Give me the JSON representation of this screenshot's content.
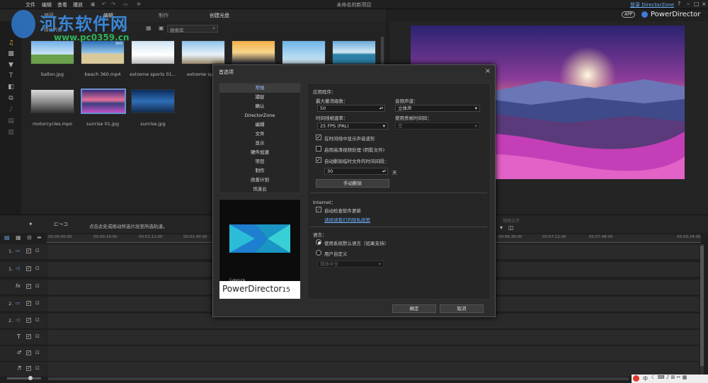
{
  "menubar": {
    "items": [
      "文件",
      "编辑",
      "查看",
      "播放"
    ],
    "title": "未命名的新项目",
    "signin": "登录 DirectorZone",
    "help": "?"
  },
  "tabs": [
    "捕获",
    "编辑",
    "制作",
    "创建光盘"
  ],
  "header": {
    "app_badge": "APP",
    "brand": "PowerDirector"
  },
  "library": {
    "filter_label": "媒体内容",
    "search_placeholder": "搜索库",
    "items": [
      {
        "label": "ballon.jpg"
      },
      {
        "label": "beach 360.mp4",
        "badge": "360"
      },
      {
        "label": "extreme sports 01..."
      },
      {
        "label": "extreme sport"
      },
      {
        "label": ""
      },
      {
        "label": ""
      },
      {
        "label": ""
      },
      {
        "label": "motorcycles.mpo"
      },
      {
        "label": "sunrise 01.jpg"
      },
      {
        "label": "sunrise.jpg"
      }
    ]
  },
  "midbar": {
    "hint": "点击此处或拖动所选片段至所选轨道。",
    "preview_dropdown": "视频文字"
  },
  "ruler": [
    "00:00:00:00",
    "00:00:16:00",
    "00:01:12:00",
    "00:01:40:00",
    "00:06:36:00",
    "00:07:12:00",
    "00:07:48:00",
    "00:09:24:00"
  ],
  "tracks": [
    {
      "name": "1.",
      "icon": "video-track-icon"
    },
    {
      "name": "1.",
      "icon": "audio-track-icon"
    },
    {
      "name": "fx",
      "icon": "fx-track-icon"
    },
    {
      "name": "2.",
      "icon": "video-track-icon"
    },
    {
      "name": "2.",
      "icon": "audio-track-icon"
    },
    {
      "name": "T",
      "icon": "title-track-icon"
    },
    {
      "name": "",
      "icon": "voice-track-icon"
    },
    {
      "name": "",
      "icon": "music-track-icon"
    }
  ],
  "dialog": {
    "title": "首选项",
    "close": "×",
    "nav": [
      "常规",
      "捕捉",
      "确认",
      "DirectorZone",
      "编辑",
      "文件",
      "显示",
      "硬件加速",
      "项目",
      "制作",
      "改善计划",
      "讯连云"
    ],
    "active_nav": 0,
    "logo": {
      "cyberlink": "CyberLink",
      "name": "PowerDirector",
      "version": "15"
    },
    "sections": {
      "app": {
        "heading": "应用程序：",
        "max_undo_label": "最大撤消级数：",
        "max_undo_value": "50",
        "audio_channel_label": "音频声道：",
        "audio_channel_value": "立体声",
        "timeline_fps_label": "时间线帧速率：",
        "timeline_fps_value": "25 FPS (PAL)",
        "drop_frame_label": "使用丢帧时间码：",
        "drop_frame_value": "是",
        "cb1": "在时间线中显示声音波形",
        "cb2": "启用高清视频处理 (阴影文件)",
        "cb3": "自动删除临时文件的时间间隔：",
        "days_value": "30",
        "days_unit": "天",
        "manual_delete": "手动删除"
      },
      "internet": {
        "heading": "Internet：",
        "cb": "自动检查软件更新",
        "link": "请阅读我们的隐私政策"
      },
      "language": {
        "heading": "语言：",
        "opt1": "使用系统默认语言（如果支持）",
        "opt2": "用户自定义",
        "custom_value": "简体中文"
      }
    },
    "ok": "确定",
    "cancel": "取消"
  },
  "watermark": {
    "line1": "河东软件网",
    "line2": "www.pc0359.cn"
  },
  "tray": {
    "text": "中"
  }
}
